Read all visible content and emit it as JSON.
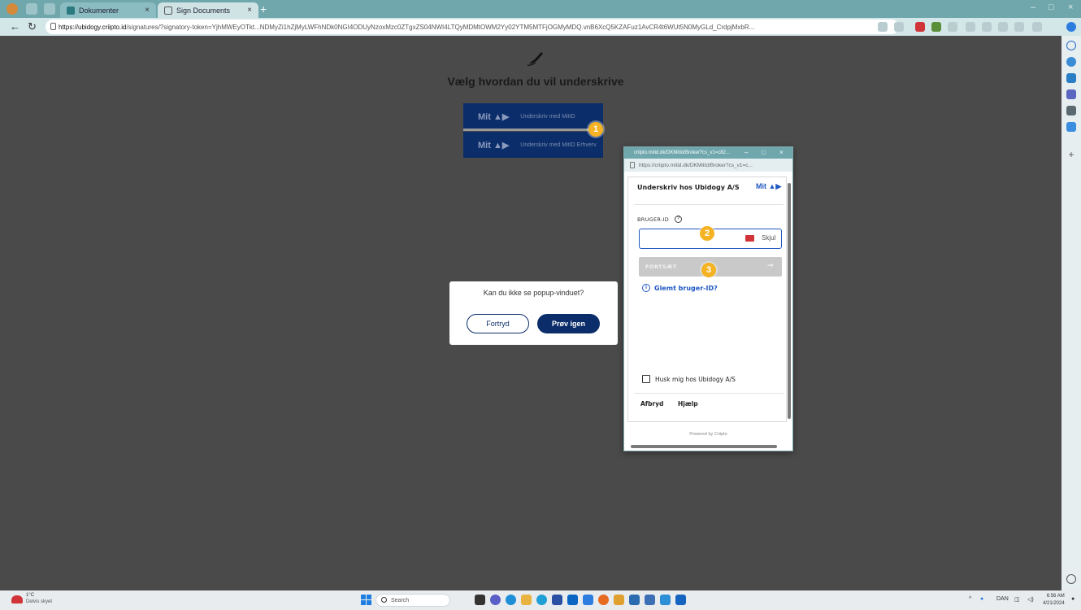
{
  "browser": {
    "tabs": [
      {
        "label": "Dokumenter",
        "close": "×"
      },
      {
        "label": "Sign Documents",
        "close": "×"
      }
    ],
    "new_tab": "+",
    "url_domain": "https://ubidogy.criipto.id",
    "url_rest": "/signatures/?signatory-token=YjhMWEyOTkt...NDMyZi1hZjMyLWFhNDk0NGI4ODUyNzoxMzc0ZTgxZS04NWI4LTQyMDMtOWM2Yy02YTM5MTFjOGMyMDQ.vnB6XcQ5KZAFuz1AvCR4t6WUt5N0MyGLd_CrdpjMxbR...",
    "window_controls": {
      "minimize": "–",
      "maximize": "□",
      "close": "×"
    }
  },
  "page": {
    "title": "Vælg hvordan du vil underskrive",
    "options": [
      {
        "logo": "Mit",
        "label": "Underskriv med MitID"
      },
      {
        "logo": "Mit",
        "label": "Underskriv med MitID Erhverv"
      }
    ]
  },
  "markers": [
    "1",
    "2",
    "3"
  ],
  "retry_dialog": {
    "question": "Kan du ikke se popup-vinduet?",
    "cancel": "Fortryd",
    "retry": "Prøv igen"
  },
  "popup": {
    "window_title": "criipto.mitid.dk/DKMitId/Broker?cs_v1=c82...",
    "controls": {
      "minimize": "–",
      "maximize": "□",
      "close": "×"
    },
    "url": "https://criipto.mitid.dk/DKMitId/Broker?cs_v1=c...",
    "heading": "Underskriv hos Ubidogy A/S",
    "logo": "Mit",
    "user_id_label": "BRUGER-ID",
    "help_glyph": "?",
    "user_id_value": "",
    "hide_label": "Skjul",
    "continue_label": "FORTSÆT",
    "continue_arrow": "→",
    "forgot_glyph": "i",
    "forgot_link": "Glemt bruger-ID?",
    "remember_label": "Husk mig hos Ubidogy A/S",
    "cancel_link": "Afbryd",
    "help_link": "Hjælp",
    "powered_by": "Powered by Criipto"
  },
  "taskbar": {
    "weather_temp": "1°C",
    "weather_desc": "Delvis skyet",
    "search_placeholder": "Search",
    "language": "DAN",
    "time": "6:56 AM",
    "date": "4/21/2024"
  },
  "colors": {
    "mitid_blue": "#0b2d69",
    "link_blue": "#1f57c3",
    "marker": "#f5b323",
    "tab_teal": "#6fa7ad",
    "page_bg": "#4a4a4a"
  }
}
